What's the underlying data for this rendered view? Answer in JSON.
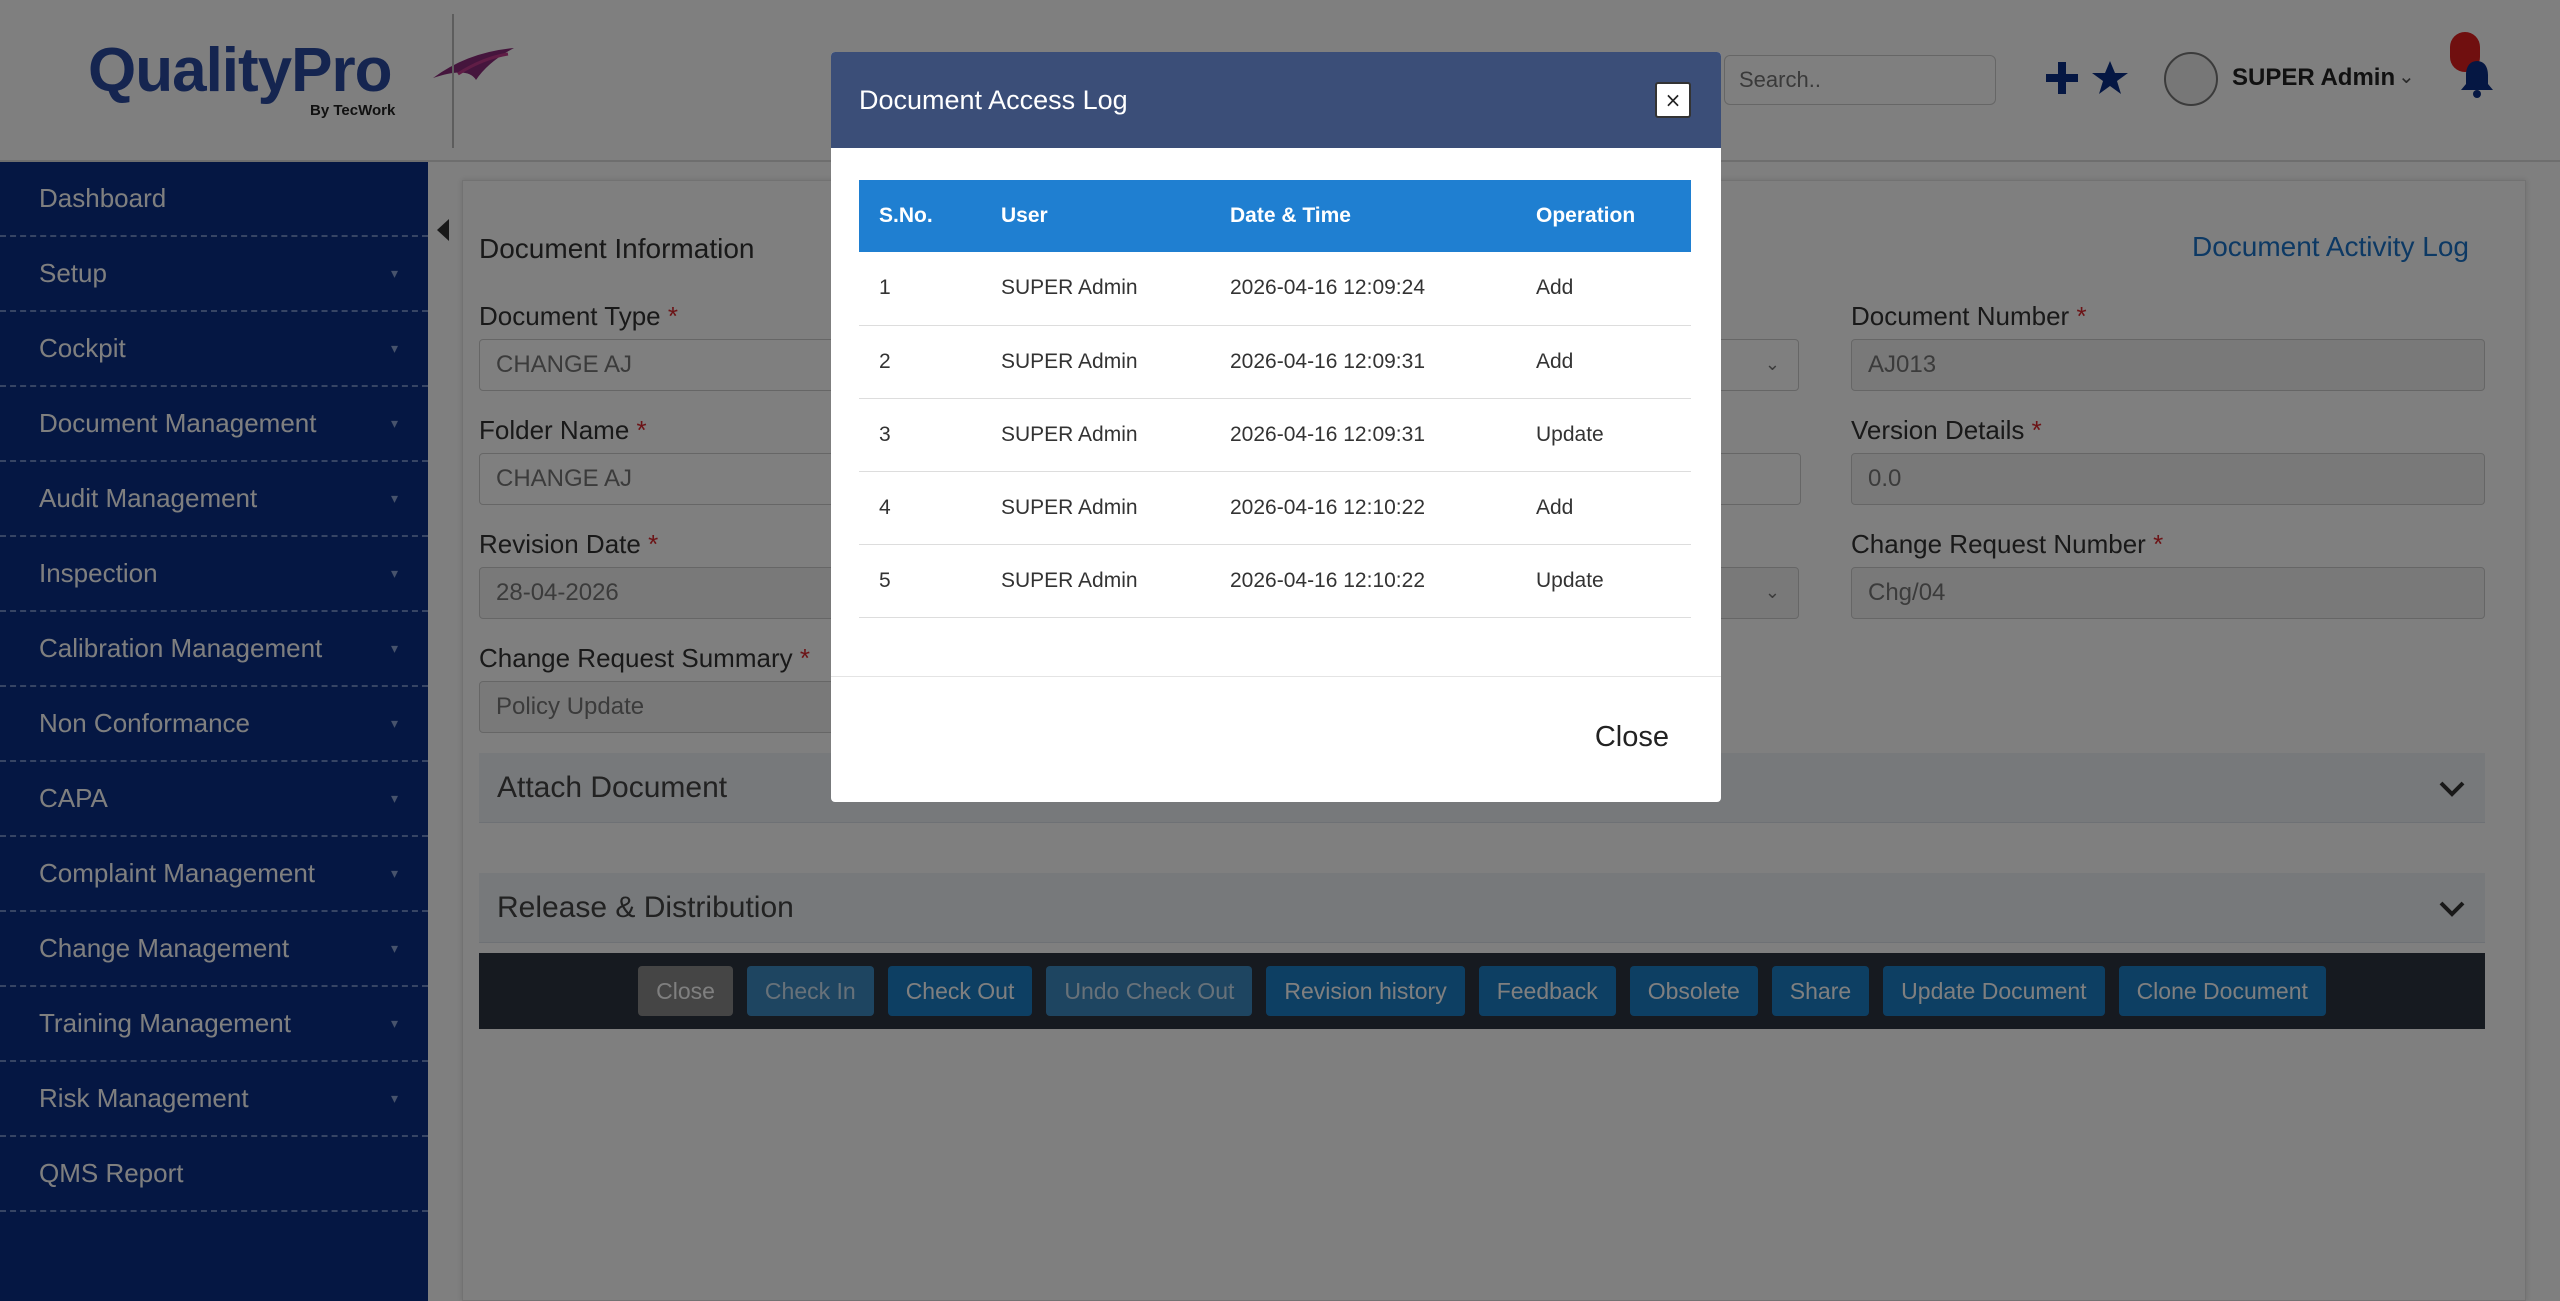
{
  "header": {
    "logo_main": "QualityPro",
    "logo_sub": "By TecWork",
    "search_placeholder": "Search..",
    "user_name": "SUPER Admin"
  },
  "sidebar": {
    "items": [
      {
        "label": "Dashboard"
      },
      {
        "label": "Setup"
      },
      {
        "label": "Cockpit"
      },
      {
        "label": "Document Management"
      },
      {
        "label": "Audit Management"
      },
      {
        "label": "Inspection"
      },
      {
        "label": "Calibration Management"
      },
      {
        "label": "Non Conformance"
      },
      {
        "label": "CAPA"
      },
      {
        "label": "Complaint Management"
      },
      {
        "label": "Change Management"
      },
      {
        "label": "Training Management"
      },
      {
        "label": "Risk Management"
      },
      {
        "label": "QMS Report"
      }
    ]
  },
  "main": {
    "section_title": "Document Information",
    "activity_link": "Document Activity Log",
    "fields": {
      "document_type": {
        "label": "Document Type",
        "value": "CHANGE AJ"
      },
      "folder_name": {
        "label": "Folder Name",
        "value": "CHANGE AJ"
      },
      "revision_date": {
        "label": "Revision Date",
        "value": "28-04-2026"
      },
      "change_request_summary": {
        "label": "Change Request Summary",
        "value": "Policy Update"
      },
      "document_number": {
        "label": "Document Number",
        "value": "AJ013"
      },
      "version_details": {
        "label": "Version Details",
        "value": "0.0"
      },
      "change_request_number": {
        "label": "Change Request Number",
        "value": "Chg/04"
      }
    },
    "required_mark": "*",
    "accordions": {
      "attach": "Attach Document",
      "release": "Release & Distribution"
    },
    "actions": [
      "Close",
      "Check In",
      "Check Out",
      "Undo Check Out",
      "Revision history",
      "Feedback",
      "Obsolete",
      "Share",
      "Update Document",
      "Clone Document"
    ]
  },
  "modal": {
    "title": "Document Access Log",
    "close_x": "×",
    "columns": [
      "S.No.",
      "User",
      "Date & Time",
      "Operation"
    ],
    "rows": [
      [
        "1",
        "SUPER Admin",
        "2026-04-16 12:09:24",
        "Add"
      ],
      [
        "2",
        "SUPER Admin",
        "2026-04-16 12:09:31",
        "Add"
      ],
      [
        "3",
        "SUPER Admin",
        "2026-04-16 12:09:31",
        "Update"
      ],
      [
        "4",
        "SUPER Admin",
        "2026-04-16 12:10:22",
        "Add"
      ],
      [
        "5",
        "SUPER Admin",
        "2026-04-16 12:10:22",
        "Update"
      ]
    ],
    "close_label": "Close"
  },
  "colors": {
    "sidebar": "#0b2f86",
    "modal_header": "#3b4e78",
    "table_header": "#1f7fd1",
    "link": "#1a73c9",
    "required": "#d9262c"
  }
}
